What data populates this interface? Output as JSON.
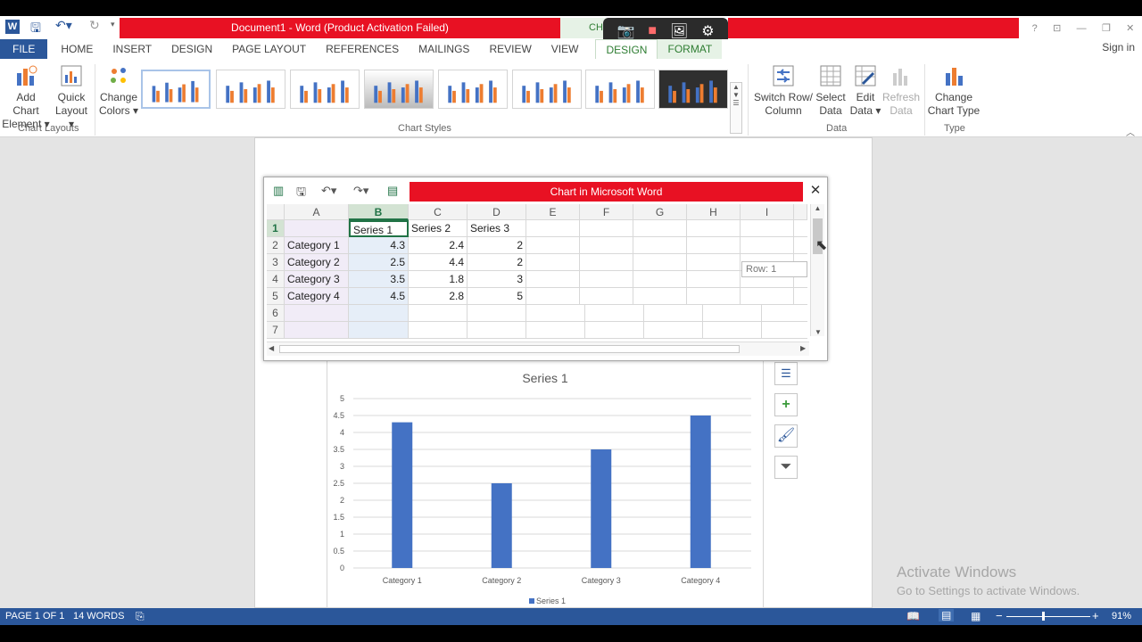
{
  "window": {
    "title": "Document1 - Word (Product Activation Failed)",
    "context_tab_header": "CHA",
    "controls": [
      "?",
      "⊡",
      "—",
      "❐",
      "✕"
    ],
    "sign_in": "Sign in"
  },
  "tabs": [
    "FILE",
    "HOME",
    "INSERT",
    "DESIGN",
    "PAGE LAYOUT",
    "REFERENCES",
    "MAILINGS",
    "REVIEW",
    "VIEW"
  ],
  "context_tabs": [
    "DESIGN",
    "FORMAT"
  ],
  "ribbon": {
    "add_chart_element": {
      "line1": "Add Chart",
      "line2": "Element ▾"
    },
    "quick_layout": {
      "line1": "Quick",
      "line2": "Layout ▾"
    },
    "change_colors": {
      "line1": "Change",
      "line2": "Colors ▾"
    },
    "group_chart_layouts": "Chart Layouts",
    "group_chart_styles": "Chart Styles",
    "switch_row_column": {
      "line1": "Switch Row/",
      "line2": "Column"
    },
    "select_data": {
      "line1": "Select",
      "line2": "Data"
    },
    "edit_data": {
      "line1": "Edit",
      "line2": "Data ▾"
    },
    "refresh_data": {
      "line1": "Refresh",
      "line2": "Data"
    },
    "group_data": "Data",
    "change_chart_type": {
      "line1": "Change",
      "line2": "Chart Type"
    },
    "group_type": "Type"
  },
  "datasheet": {
    "title": "Chart in Microsoft Word",
    "columns": [
      "A",
      "B",
      "C",
      "D",
      "E",
      "F",
      "G",
      "H",
      "I"
    ],
    "rows": [
      "1",
      "2",
      "3",
      "4",
      "5",
      "6",
      "7"
    ],
    "header_row": [
      "",
      "Series 1",
      "Series 2",
      "Series 3"
    ],
    "data_rows": [
      [
        "Category 1",
        "4.3",
        "2.4",
        "2"
      ],
      [
        "Category 2",
        "2.5",
        "4.4",
        "2"
      ],
      [
        "Category 3",
        "3.5",
        "1.8",
        "3"
      ],
      [
        "Category 4",
        "4.5",
        "2.8",
        "5"
      ]
    ],
    "row_tooltip": "Row: 1"
  },
  "chart_data": {
    "type": "bar",
    "title": "Series 1",
    "categories": [
      "Category 1",
      "Category 2",
      "Category 3",
      "Category 4"
    ],
    "series": [
      {
        "name": "Series 1",
        "values": [
          4.3,
          2.5,
          3.5,
          4.5
        ],
        "color": "#4472c4"
      }
    ],
    "ylim": [
      0,
      5
    ],
    "yticks": [
      "0",
      "0.5",
      "1",
      "1.5",
      "2",
      "2.5",
      "3",
      "3.5",
      "4",
      "4.5",
      "5"
    ],
    "legend_position": "bottom",
    "grid": true
  },
  "chart_side_buttons": [
    "layout-options-icon",
    "add-element-icon",
    "brush-icon",
    "filter-icon"
  ],
  "statusbar": {
    "page": "PAGE 1 OF 1",
    "words": "14 WORDS",
    "zoom": "91%"
  },
  "watermark": {
    "line1": "Activate Windows",
    "line2": "Go to Settings to activate Windows."
  },
  "recorder_icons": [
    "camera-icon",
    "video-icon",
    "image-icon",
    "gear-icon"
  ]
}
